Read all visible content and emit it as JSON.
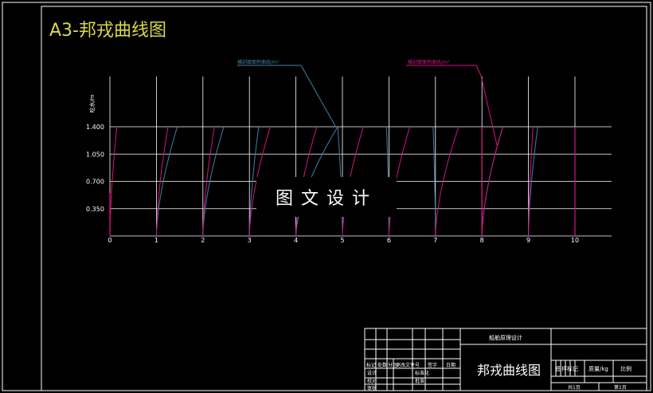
{
  "sheet": {
    "title": "A3-邦戎曲线图",
    "watermark": "图文设计"
  },
  "colors": {
    "background": "#000000",
    "grid": "#ffffff",
    "cyan_series": "#3f7fa6",
    "magenta_series": "#d4157f",
    "title": "#d9d94a"
  },
  "chart_data": {
    "type": "line",
    "ylabel": "吃水/m",
    "yticks": [
      "1.400",
      "1.050",
      "0.700",
      "0.350"
    ],
    "xticks": [
      "0",
      "1",
      "2",
      "3",
      "4",
      "5",
      "6",
      "7",
      "8",
      "9",
      "10"
    ],
    "xlim": [
      0,
      10
    ],
    "ylim": [
      0,
      1.4
    ],
    "grid": true,
    "series": [
      {
        "name": "横剖面面积曲线/m²",
        "color": "#3f7fa6",
        "stations": [
          1,
          2,
          3,
          4,
          5,
          6,
          7,
          8,
          9
        ],
        "x_at_max_draft": [
          1.45,
          2.45,
          3.2,
          4.9,
          4.9,
          5.95,
          6.95,
          8.45,
          9.2
        ]
      },
      {
        "name": "横剖面面积曲线/m²",
        "color": "#d4157f",
        "stations": [
          0,
          1,
          2,
          3,
          4,
          5,
          6,
          7,
          8,
          9
        ],
        "x_at_max_draft": [
          0.15,
          1.25,
          2.25,
          3.45,
          4.45,
          5.45,
          6.45,
          7.5,
          8.45,
          9.1
        ]
      }
    ]
  },
  "title_block": {
    "project": "船舶原理设计",
    "drawing_title": "邦戎曲线图",
    "row_labels": [
      "标记",
      "处数",
      "分区",
      "更改文件号",
      "签字",
      "日期"
    ],
    "left_labels": [
      "设计",
      "校对",
      "审核"
    ],
    "mid_labels": [
      "标准化",
      "批准"
    ],
    "right_headers": [
      "图样标记",
      "质量/kg",
      "比例"
    ],
    "sheet_labels": [
      "共1页",
      "第1页"
    ]
  }
}
